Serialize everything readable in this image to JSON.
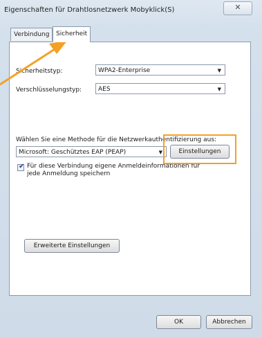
{
  "window": {
    "title": "Eigenschaften für Drahtlosnetzwerk Mobyklick(S)",
    "close_label": "✕"
  },
  "tabs": [
    {
      "label": "Verbindung"
    },
    {
      "label": "Sicherheit"
    }
  ],
  "security": {
    "type_label": "Sicherheitstyp:",
    "type_value": "WPA2-Enterprise",
    "encryption_label": "Verschlüsselungstyp:",
    "encryption_value": "AES",
    "method_label": "Wählen Sie eine Methode für die Netzwerkauthentifizierung aus:",
    "method_value": "Microsoft: Geschütztes EAP (PEAP)",
    "settings_button": "Einstellungen",
    "remember_line1": "Für diese Verbindung eigene Anmeldeinformationen für",
    "remember_line2": "jede Anmeldung speichern",
    "advanced_button": "Erweiterte Einstellungen"
  },
  "footer": {
    "ok_button": "OK",
    "cancel_button": "Abbrechen"
  },
  "colors": {
    "highlight": "#f5a023"
  }
}
